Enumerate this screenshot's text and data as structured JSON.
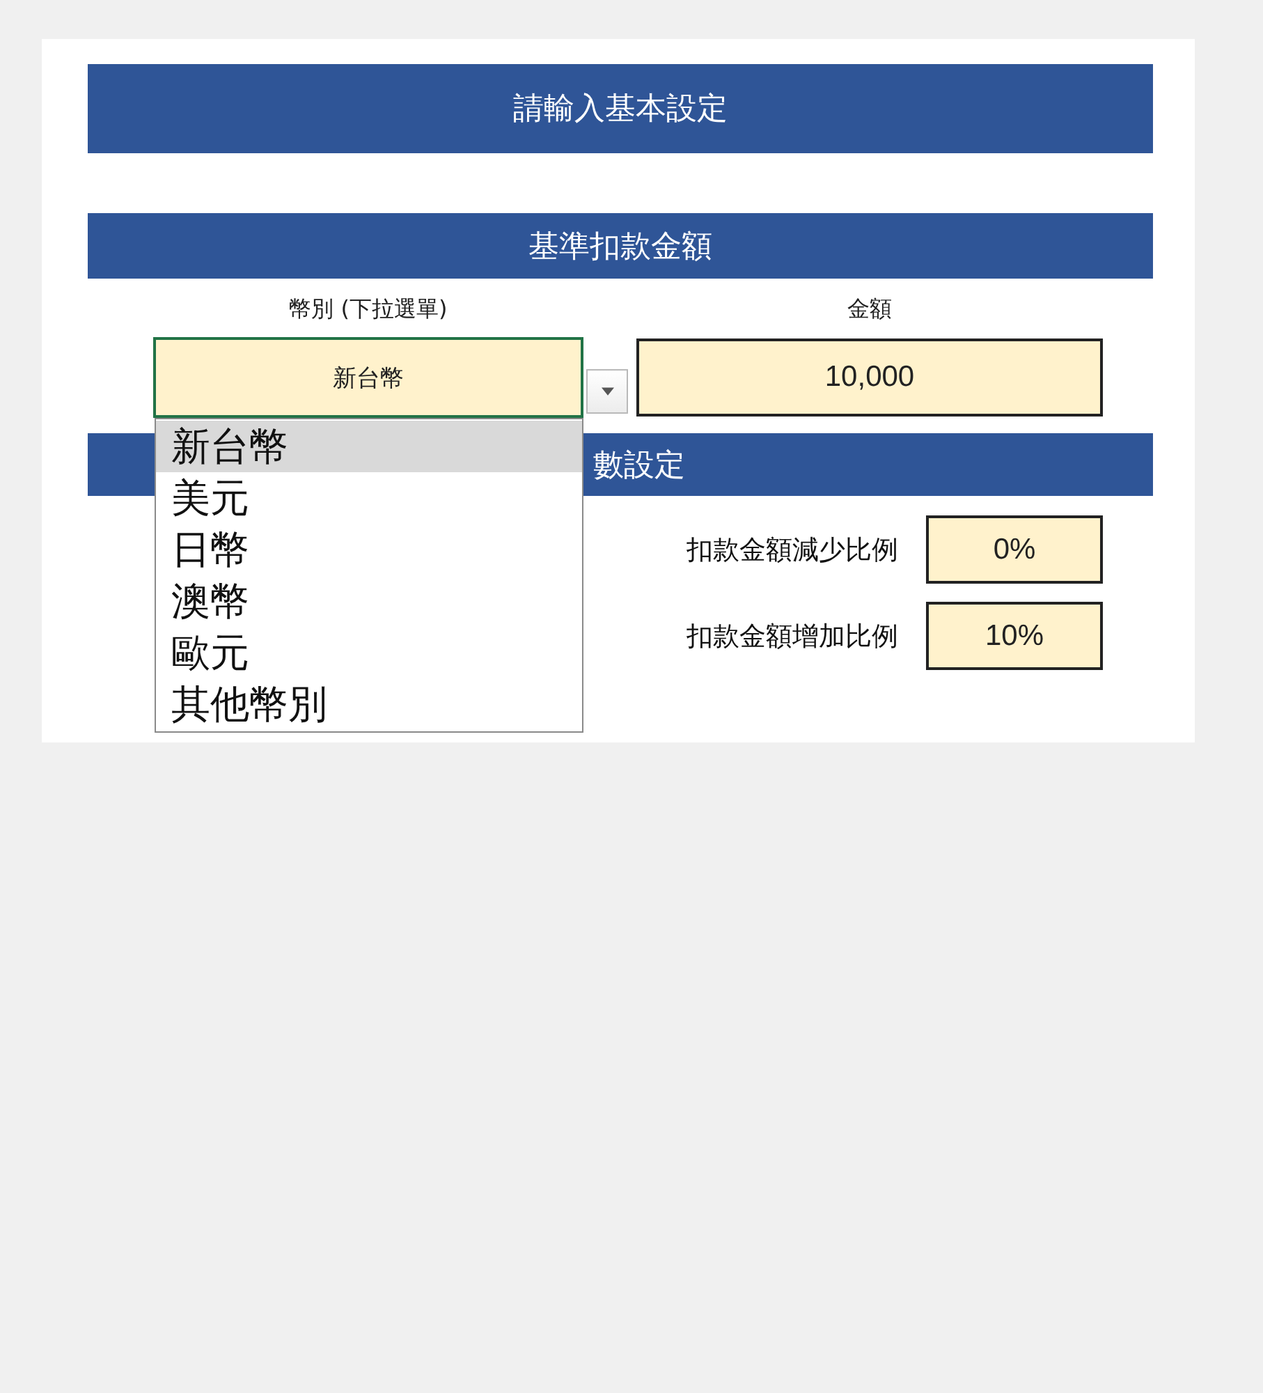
{
  "banner": {
    "title": "請輸入基本設定"
  },
  "base_amount": {
    "title": "基準扣款金額",
    "currency": {
      "label": "幣別 (下拉選單)",
      "value": "新台幣",
      "selected": true
    },
    "amount": {
      "label": "金額",
      "value": "10,000"
    }
  },
  "parameters": {
    "title": "數設定",
    "rows": [
      {
        "label": "扣款金額減少比例",
        "value": "0%"
      },
      {
        "label": "扣款金額增加比例",
        "value": "10%"
      }
    ]
  },
  "dropdown": {
    "expanded": true,
    "options": [
      {
        "label": "新台幣",
        "selected": true
      },
      {
        "label": "美元",
        "selected": false
      },
      {
        "label": "日幣",
        "selected": false
      },
      {
        "label": "澳幣",
        "selected": false
      },
      {
        "label": "歐元",
        "selected": false
      },
      {
        "label": "其他幣別",
        "selected": false
      }
    ]
  }
}
